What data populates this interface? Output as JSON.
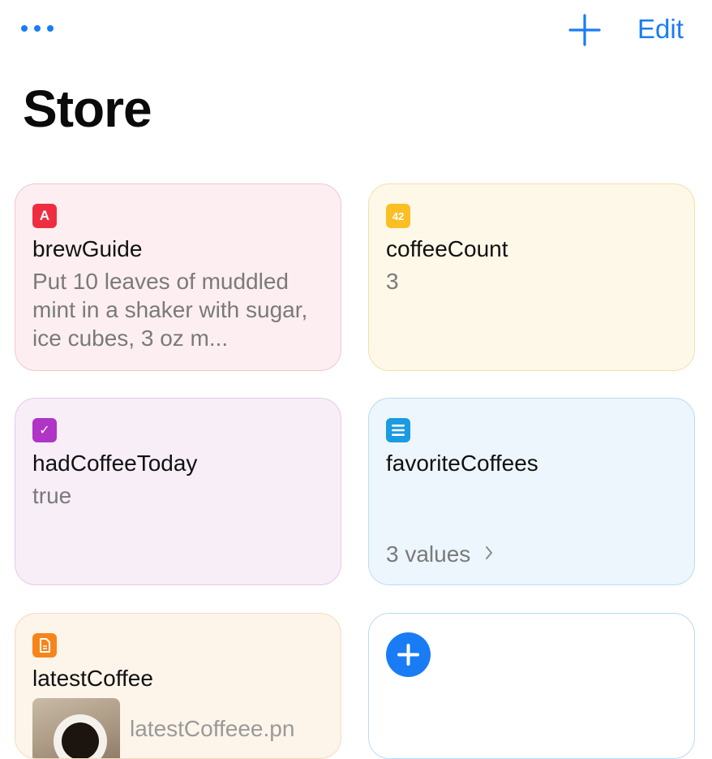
{
  "header": {
    "more_icon": "ellipsis-icon",
    "add_icon": "plus-icon",
    "edit_label": "Edit",
    "accent_color": "#1a7cf5"
  },
  "page": {
    "title": "Store"
  },
  "cards": [
    {
      "type_icon": "text-type-icon",
      "badge": "A",
      "name": "brewGuide",
      "value": "Put 10 leaves of muddled mint in a shaker with sugar, ice cubes, 3 oz m...",
      "color": "#ef2d40"
    },
    {
      "type_icon": "number-type-icon",
      "badge": "42",
      "name": "coffeeCount",
      "value": "3",
      "color": "#fbbf24"
    },
    {
      "type_icon": "checkbox-type-icon",
      "badge": "✓",
      "name": "hadCoffeeToday",
      "value": "true",
      "color": "#b034c6"
    },
    {
      "type_icon": "list-type-icon",
      "name": "favoriteCoffees",
      "value": "3 values",
      "color": "#1b9be0"
    },
    {
      "type_icon": "file-type-icon",
      "name": "latestCoffee",
      "value": "latestCoffeee.pn",
      "color": "#f7841a"
    }
  ],
  "new_card": {
    "icon": "plus-circle-icon"
  }
}
